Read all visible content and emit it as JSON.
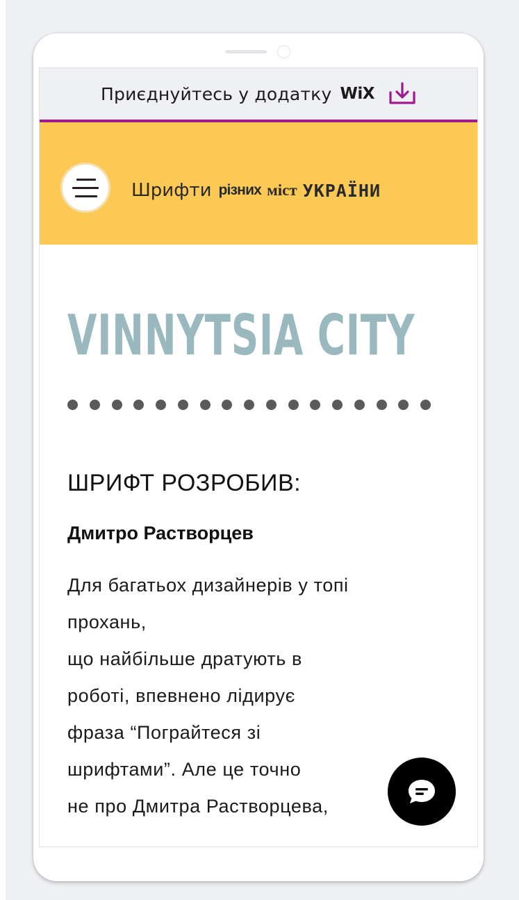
{
  "banner": {
    "text": "Приєднуйтесь у додатку",
    "brand": "WiX",
    "download_icon": "download-icon",
    "accent_color": "#9e1b8f"
  },
  "header": {
    "background_color": "#fdc955",
    "menu_icon": "hamburger-icon",
    "title_parts": [
      "Шрифти",
      "різних",
      "міст",
      "УКРАЇНИ"
    ]
  },
  "hero": {
    "title": "VINNYTSIA CITY",
    "title_color": "#99b9be",
    "separator_dots": 17
  },
  "content": {
    "heading": "ШРИФТ РОЗРОБИВ:",
    "author": "Дмитро Растворцев",
    "body_lines": [
      "Для багатьох дизайнерів у топі",
      "прохань,",
      "що найбільше дратують в",
      "роботі, впевнено лідирує",
      "фраза “Пограйтеся зі",
      "шрифтами”. Але це точно",
      "не про Дмитра Растворцева,"
    ]
  },
  "chat": {
    "icon": "chat-icon"
  }
}
